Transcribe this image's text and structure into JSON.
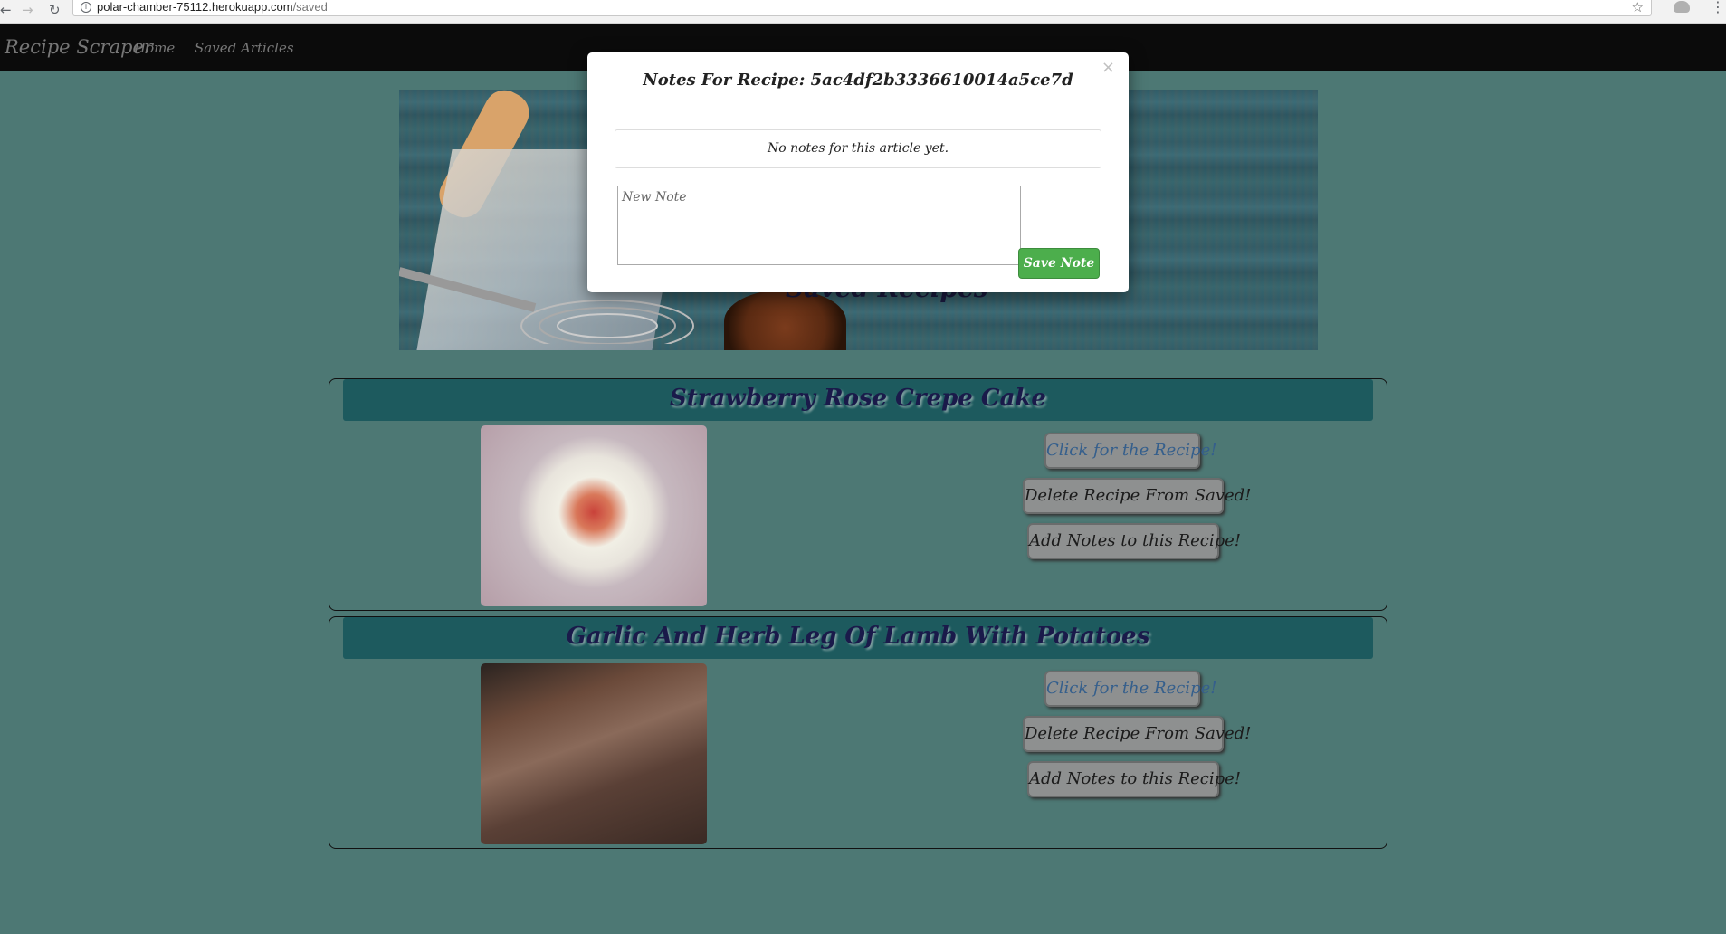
{
  "browser": {
    "url_host": "polar-chamber-75112.herokuapp.com",
    "url_path": "/saved",
    "back_icon": "arrow-left-icon",
    "forward_icon": "arrow-right-icon",
    "reload_icon": "reload-icon",
    "info_icon": "info-icon",
    "star_icon": "star-icon",
    "menu_icon": "menu-dots-icon"
  },
  "navbar": {
    "brand": "Recipe Scraper",
    "links": [
      "Home",
      "Saved Articles"
    ]
  },
  "jumbotron": {
    "title": "Saved Recipes"
  },
  "recipes": [
    {
      "title": "Strawberry Rose Crepe Cake",
      "buttons": {
        "link": "Click for the Recipe!",
        "delete": "Delete Recipe From Saved!",
        "notes": "Add Notes to this Recipe!"
      }
    },
    {
      "title": "Garlic And Herb Leg Of Lamb With Potatoes",
      "buttons": {
        "link": "Click for the Recipe!",
        "delete": "Delete Recipe From Saved!",
        "notes": "Add Notes to this Recipe!"
      }
    }
  ],
  "modal": {
    "close": "×",
    "title": "Notes For Recipe: 5ac4df2b3336610014a5ce7d",
    "empty_text": "No notes for this article yet.",
    "input_placeholder": "New Note",
    "save_label": "Save Note"
  },
  "colors": {
    "page_bg": "#4d7874",
    "navbar_bg": "#0b0b0b",
    "card_header_bg": "#1d5a5e",
    "button_bg": "#8e9090",
    "save_button_bg": "#4cae4c"
  }
}
